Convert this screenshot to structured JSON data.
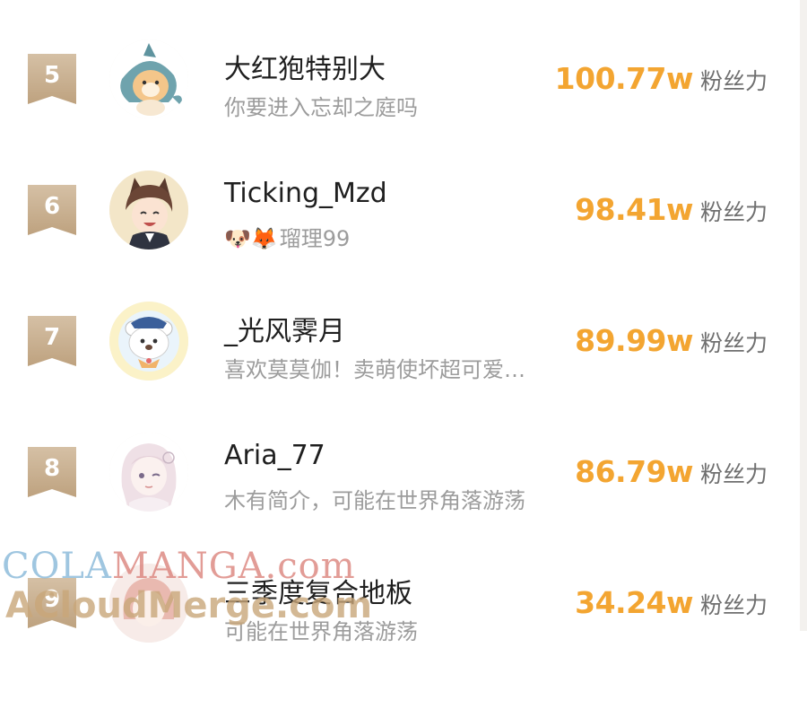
{
  "rows": [
    {
      "rank": "5",
      "name": "大红狍特别大",
      "bio_emoji": "",
      "bio": "你要进入忘却之庭吗",
      "fans_value": "100.77w",
      "fans_unit": "粉丝力",
      "avatar_icon": "shark-cat-avatar"
    },
    {
      "rank": "6",
      "name": "Ticking_Mzd",
      "bio_emoji": "🐶🦊",
      "bio": "瑠理99",
      "fans_value": "98.41w",
      "fans_unit": "粉丝力",
      "avatar_icon": "boy-cat-ears-avatar"
    },
    {
      "rank": "7",
      "name": "_光风霁月",
      "bio_emoji": "",
      "bio": "喜欢莫莫伽！卖萌使坏超可爱…",
      "fans_value": "89.99w",
      "fans_unit": "粉丝力",
      "avatar_icon": "bear-sailor-avatar"
    },
    {
      "rank": "8",
      "name": "Aria_77",
      "bio_emoji": "",
      "bio": "木有简介，可能在世界角落游荡",
      "fans_value": "86.79w",
      "fans_unit": "粉丝力",
      "avatar_icon": "anime-girl-avatar"
    },
    {
      "rank": "9",
      "name": "三季度复合地板",
      "bio_emoji": "",
      "bio": "可能在世界角落游荡",
      "fans_value": "34.24w",
      "fans_unit": "粉丝力",
      "avatar_icon": "anime-avatar"
    }
  ],
  "watermark": {
    "line1_a": "COLA",
    "line1_b": "MANGA",
    "line1_c": ".com",
    "line2": "ACloudMerge.com"
  },
  "colors": {
    "accent": "#f3a531",
    "rank_badge": "#c9ae8c",
    "name": "#1f1f1f",
    "bio": "#9c9c9c"
  }
}
